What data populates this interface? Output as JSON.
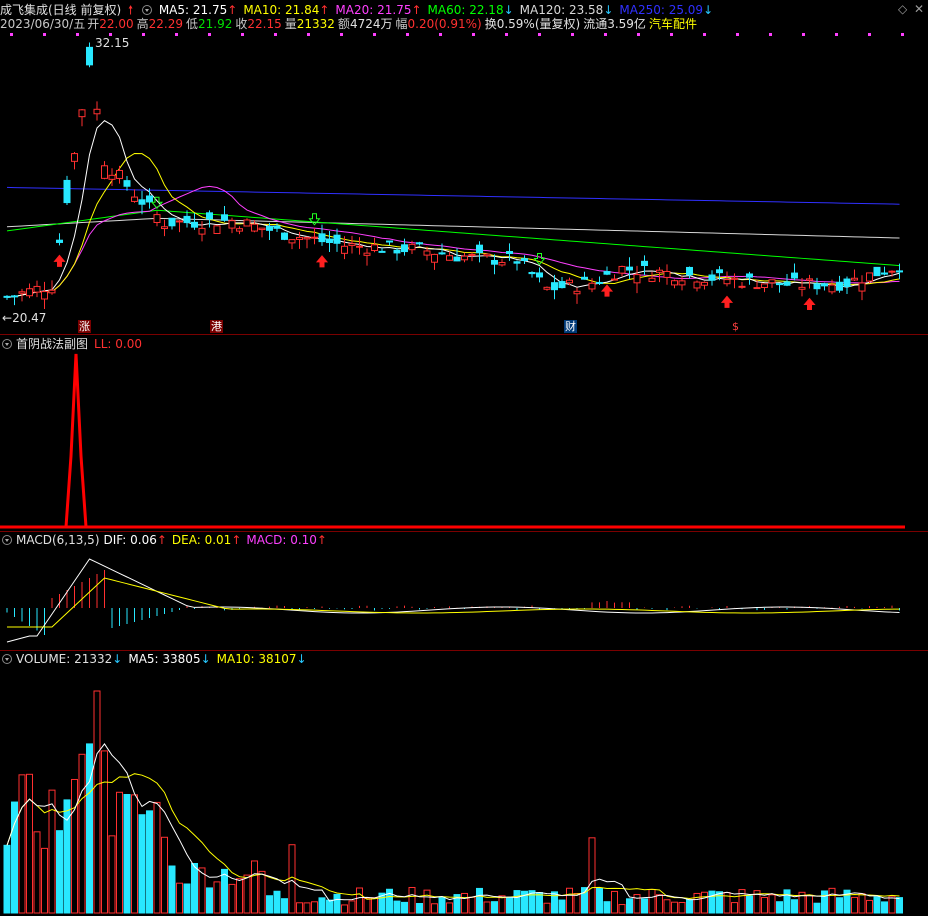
{
  "header": {
    "stock_name": "成飞集成(日线 前复权)",
    "ma": [
      {
        "label": "MA5: 21.75",
        "color": "#ffffff",
        "arrow": "↑",
        "arrow_color": "#ff3030"
      },
      {
        "label": "MA10: 21.84",
        "color": "#ffff00",
        "arrow": "↑",
        "arrow_color": "#ff3030"
      },
      {
        "label": "MA20: 21.75",
        "color": "#ff40ff",
        "arrow": "↑",
        "arrow_color": "#ff3030"
      },
      {
        "label": "MA60: 22.18",
        "color": "#00ff00",
        "arrow": "↓",
        "arrow_color": "#28c8ff"
      },
      {
        "label": "MA120: 23.58",
        "color": "#d8d8d8",
        "arrow": "↓",
        "arrow_color": "#28c8ff"
      },
      {
        "label": "MA250: 25.09",
        "color": "#3030ff",
        "arrow": "↓",
        "arrow_color": "#28c8ff"
      }
    ],
    "controls": [
      "◇",
      "✕"
    ]
  },
  "quote": {
    "date": "2023/06/30/五",
    "open_label": "开",
    "open": "22.00",
    "high_label": "高",
    "high": "22.29",
    "low_label": "低",
    "low": "21.92",
    "close_label": "收",
    "close": "22.15",
    "vol_label": "量",
    "vol": "21332",
    "amt_label": "额",
    "amt": "4724万",
    "chg_label": "幅",
    "chg": "0.20(0.91%)",
    "turnover": "换0.59%(量复权)",
    "float": "流通3.59亿",
    "sector": "汽车配件"
  },
  "main_chart": {
    "high_label": "32.15",
    "low_label": "20.47",
    "events": [
      {
        "text": "涨",
        "bg": "#7a0000",
        "color": "#ffffff"
      },
      {
        "text": "港",
        "bg": "#7a0000",
        "color": "#ffffff"
      },
      {
        "text": "财",
        "bg": "#003a78",
        "color": "#ffffff"
      },
      {
        "text": "$",
        "bg": "#000000",
        "color": "#ff4040"
      }
    ],
    "price_range": [
      19.5,
      33.5
    ],
    "ma_colors": {
      "ma5": "#ffffff",
      "ma10": "#ffff00",
      "ma20": "#ff40ff",
      "ma60": "#00ff00",
      "ma120": "#d8d8d8",
      "ma250": "#3030ff"
    },
    "up_color": "#ff3030",
    "down_color": "#28e8ff"
  },
  "sub1": {
    "title": "首阴战法副图",
    "ll_label": "LL: 0.00",
    "color": "#ff0000"
  },
  "sub2": {
    "title": "MACD(6,13,5)",
    "dif": "DIF: 0.06",
    "dif_arrow": "↑",
    "dea": "DEA: 0.01",
    "dea_arrow": "↑",
    "macd": "MACD: 0.10",
    "macd_arrow": "↑",
    "dif_color": "#ffffff",
    "dea_color": "#ffff00",
    "macd_color": "#ff40ff"
  },
  "sub3": {
    "title": "VOLUME: 21332",
    "title_arrow": "↓",
    "ma5": "MA5: 33805",
    "ma5_arrow": "↓",
    "ma10": "MA10: 38107",
    "ma10_arrow": "↓"
  }
}
